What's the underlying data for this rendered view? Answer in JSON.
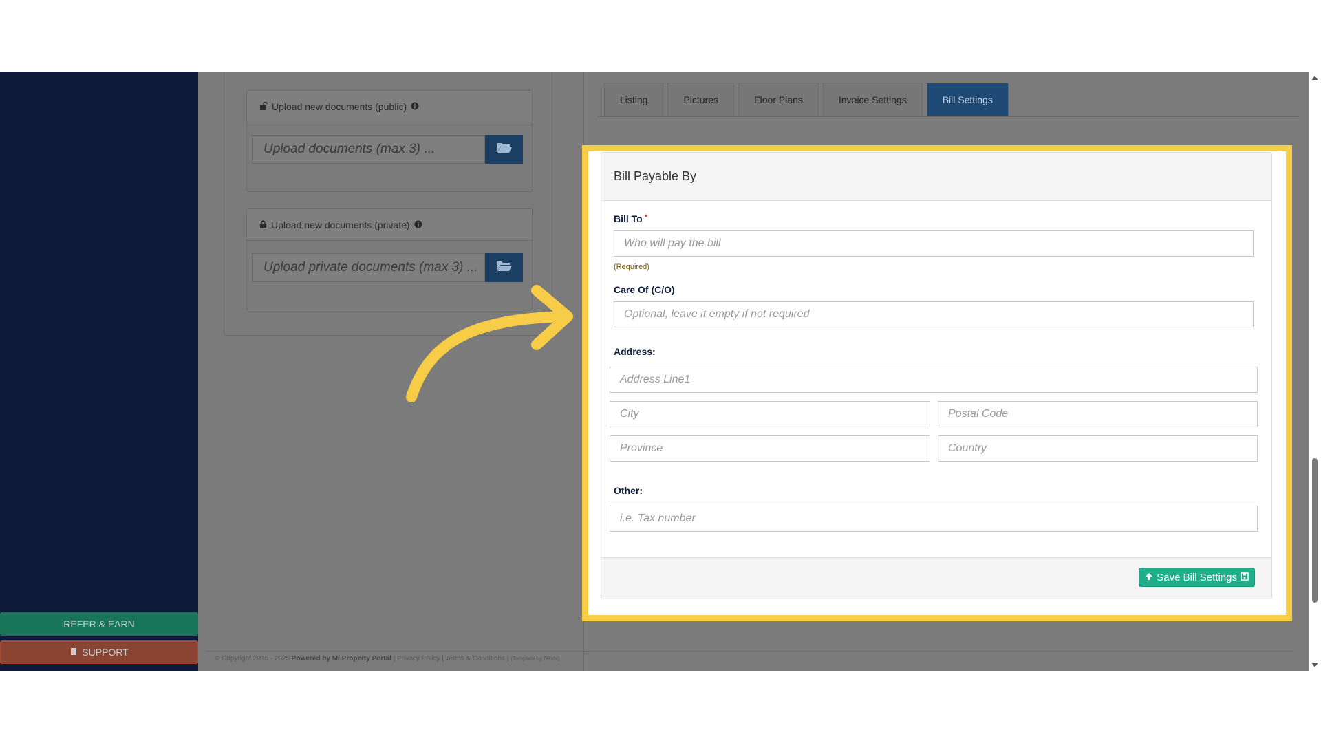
{
  "sidebar": {
    "refer_label": "REFER & EARN",
    "support_label": "SUPPORT"
  },
  "uploads": {
    "public": {
      "title": "Upload new documents (public)",
      "placeholder": "Upload documents (max 3) ..."
    },
    "private": {
      "title": "Upload new documents (private)",
      "placeholder": "Upload private documents (max 3) ..."
    }
  },
  "tabs": [
    {
      "label": "Listing"
    },
    {
      "label": "Pictures"
    },
    {
      "label": "Floor Plans"
    },
    {
      "label": "Invoice Settings"
    },
    {
      "label": "Bill Settings"
    }
  ],
  "bill": {
    "heading": "Bill Payable By",
    "bill_to_label": "Bill To",
    "bill_to_required_mark": "*",
    "bill_to_placeholder": "Who will pay the bill",
    "bill_to_help": "(Required)",
    "care_of_label": "Care Of (C/O)",
    "care_of_placeholder": "Optional, leave it empty if not required",
    "address_label": "Address:",
    "address_line1_placeholder": "Address Line1",
    "city_placeholder": "City",
    "postal_code_placeholder": "Postal Code",
    "province_placeholder": "Province",
    "country_placeholder": "Country",
    "other_label": "Other:",
    "other_placeholder": "i.e. Tax number",
    "save_label": "Save Bill Settings"
  },
  "footer": {
    "copyright": "© Copyright 2016 - 2025",
    "powered_by": "Powered by Mi Property Portal",
    "links": "| Privacy Policy | Terms & Conditions |",
    "template_by": "(Template by Dashi)"
  },
  "colors": {
    "sidebar_bg": "#0f1a38",
    "highlight": "#f7cd48",
    "save_button": "#1fae8a",
    "active_tab": "#1f4975"
  }
}
